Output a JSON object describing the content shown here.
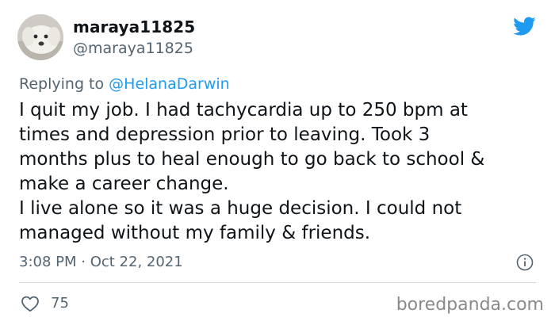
{
  "tweet": {
    "author": {
      "display_name": "maraya11825",
      "handle": "@maraya11825",
      "avatar_icon": "dog-avatar-photo"
    },
    "reply_prefix": "Replying to ",
    "reply_to": "@HelanaDarwin",
    "body_lines": [
      "I quit my job. I had tachycardia up to 250 bpm at",
      "times and depression prior to leaving. Took 3",
      "months plus to heal enough to go back to school &",
      "make a career change.",
      "I live alone so it was a huge decision. I could not",
      "managed without my family & friends."
    ],
    "timestamp": "3:08 PM · Oct 22, 2021",
    "like_count": "75"
  },
  "icons": {
    "brand": "twitter-bird-icon",
    "info": "info-icon",
    "like": "heart-icon"
  },
  "watermark": "boredpanda.com",
  "colors": {
    "brand_blue": "#1d9bf0",
    "text_primary": "#0f1419",
    "text_secondary": "#536471",
    "divider": "#cfd9de",
    "watermark": "#8a8a8a"
  }
}
